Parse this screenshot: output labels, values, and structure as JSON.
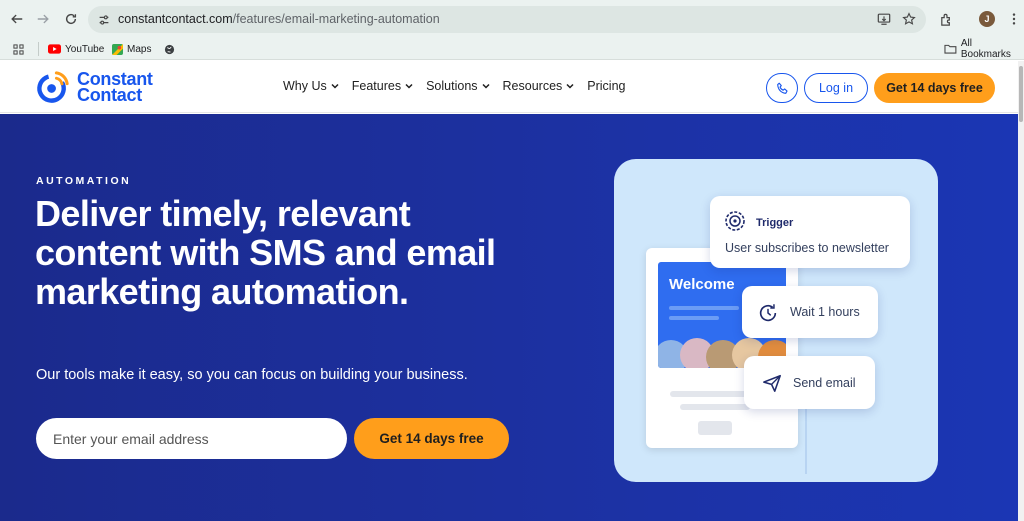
{
  "browser": {
    "url_host": "constantcontact.com",
    "url_path": "/features/email-marketing-automation",
    "profile_initial": "J",
    "bookmarks": [
      {
        "label": "YouTube",
        "icon": "youtube-icon"
      },
      {
        "label": "Maps",
        "icon": "maps-icon"
      }
    ],
    "all_bookmarks_label": "All Bookmarks"
  },
  "header": {
    "logo_line1": "Constant",
    "logo_line2": "Contact",
    "nav": [
      {
        "label": "Why Us",
        "has_dropdown": true
      },
      {
        "label": "Features",
        "has_dropdown": true
      },
      {
        "label": "Solutions",
        "has_dropdown": true
      },
      {
        "label": "Resources",
        "has_dropdown": true
      },
      {
        "label": "Pricing",
        "has_dropdown": false
      }
    ],
    "login_label": "Log in",
    "trial_label": "Get 14 days free"
  },
  "hero": {
    "eyebrow": "AUTOMATION",
    "headline": "Deliver timely, relevant content with SMS and email marketing automation.",
    "subcopy": "Our tools make it easy, so you can focus on building your business.",
    "email_placeholder": "Enter your email address",
    "cta_label": "Get 14 days free"
  },
  "illustration": {
    "welcome_text": "Welcome",
    "trigger_title": "Trigger",
    "trigger_desc": "User subscribes to newsletter",
    "wait_label": "Wait 1 hours",
    "send_label": "Send email"
  },
  "colors": {
    "brand_blue": "#1856ed",
    "cta_orange": "#ff9e1b",
    "hero_bg": "#1c31a2"
  }
}
